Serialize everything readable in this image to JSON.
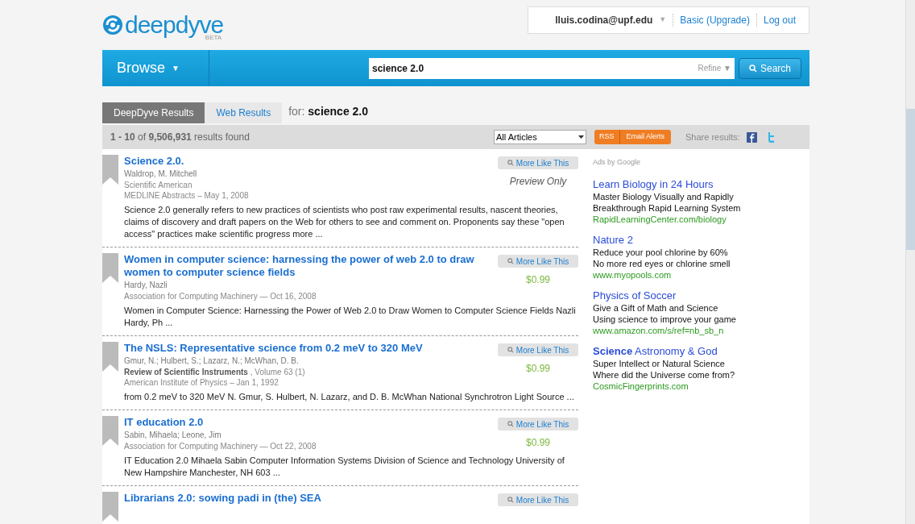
{
  "logo": {
    "name": "deepdyve",
    "badge": "BETA"
  },
  "account": {
    "user": "lluis.codina@upf.edu",
    "caret": "▼",
    "plan": "Basic (Upgrade)",
    "logout": "Log out"
  },
  "nav": {
    "browse": "Browse",
    "caret": "▼"
  },
  "search": {
    "value": "science 2.0",
    "refine": "Refine ▼",
    "button": "Search"
  },
  "tabs": [
    {
      "label": "DeepDyve Results",
      "selected": true
    },
    {
      "label": "Web Results",
      "selected": false
    }
  ],
  "query_label": {
    "prefix": "for:",
    "query": "science 2.0"
  },
  "summary": "**1 - 10** of **9,506,931** results found",
  "filter": {
    "value": "All Articles"
  },
  "rss_button": "RSS",
  "email_alerts_button": "Email Alerts",
  "share_label": "Share results:",
  "results": [
    {
      "title": "Science 2.0.",
      "authors": "Waldrop, M. Mitchell",
      "source_lines": [
        "Scientific American",
        "MEDLINE Abstracts – May 1, 2008"
      ],
      "snippet": "Science 2.0 generally refers to new practices of scientists who post raw experimental results, nascent theories, claims of discovery and draft papers on the Web for others to see and comment on. Proponents say these \"open access\" practices make scientific progress more ...",
      "button": "More Like This",
      "price": "Preview Only",
      "kind": "preview"
    },
    {
      "title": "Women in computer science: harnessing the power of web 2.0 to draw women to computer science fields",
      "authors": "Hardy, Nazli",
      "source_lines": [
        "Association for Computing Machinery — Oct 16, 2008"
      ],
      "snippet": "Women in Computer Science: Harnessing the Power of Web 2.0 to Draw Women to Computer Science Fields Nazli Hardy, Ph ...",
      "button": "More Like This",
      "price": "$0.99",
      "kind": "paid"
    },
    {
      "title": "The NSLS: Representative science from 0.2 meV to 320 MeV",
      "authors": "Gmur, N.; Hulbert, S.; Lazarz, N.; McWhan, D. B.",
      "source_lines": [
        "**Review of Scientific Instruments** , Volume 63 (1)",
        "American Institute of Physics – Jan 1, 1992"
      ],
      "snippet": "from 0.2 meV to 320 MeV N. Gmur, S. Hulbert, N. Lazarz, and D. B. McWhan National Synchrotron Light Source ...",
      "button": "More Like This",
      "price": "$0.99",
      "kind": "paid"
    },
    {
      "title": "IT education 2.0",
      "authors": "Sabin, Mihaela; Leone, Jim",
      "source_lines": [
        "Association for Computing Machinery — Oct 22, 2008"
      ],
      "snippet": "IT Education 2.0 Mihaela Sabin Computer Information Systems Division of Science and Technology University of New Hampshire Manchester, NH 603 ...",
      "button": "More Like This",
      "price": "$0.99",
      "kind": "paid"
    },
    {
      "title": "Librarians 2.0: sowing padi in (the) SEA",
      "button": "More Like This",
      "kind": "partial"
    }
  ],
  "ads": {
    "label": "Ads by Google",
    "items": [
      {
        "title": "Learn Biology in 24 Hours",
        "lines": [
          "Master Biology Visually and Rapidly",
          "Breakthrough Rapid Learning System"
        ],
        "url": "RapidLearningCenter.com/biology"
      },
      {
        "title": "Nature 2",
        "lines": [
          "Reduce your pool chlorine by 60%",
          "No more red eyes or chlorine smell"
        ],
        "url": "www.myopools.com"
      },
      {
        "title": "Physics of Soccer",
        "lines": [
          "Give a Gift of Math and Science",
          "Using science to improve your game"
        ],
        "url": "www.amazon.com/s/ref=nb_sb_n"
      },
      {
        "title": "**Science** Astronomy & God",
        "lines": [
          "Super Intellect or Natural Science",
          "Where did the Universe come from?"
        ],
        "url": "CosmicFingerprints.com"
      }
    ]
  }
}
